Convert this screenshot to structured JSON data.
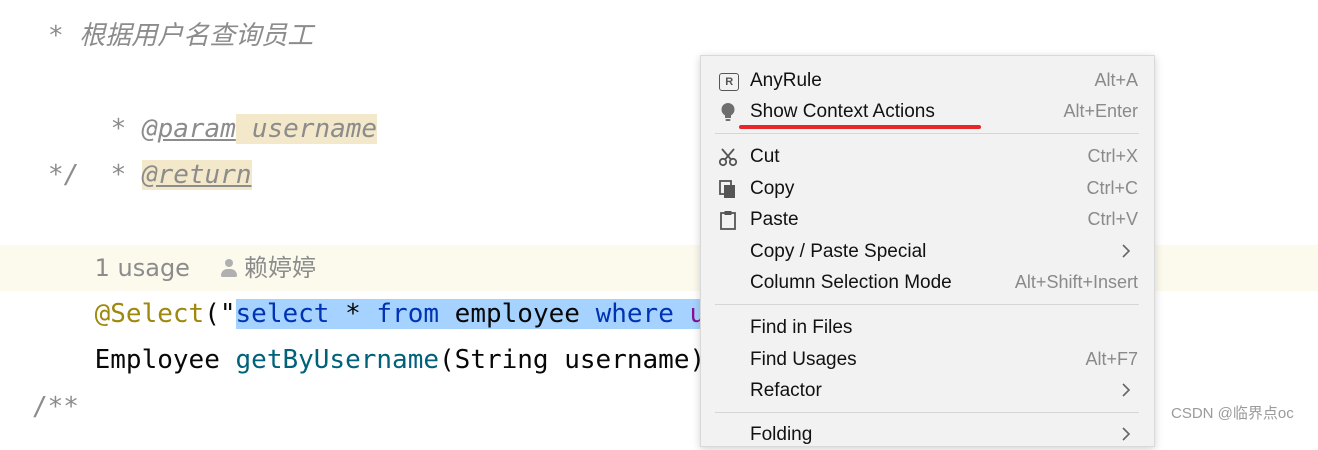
{
  "editor": {
    "comment_desc": "* 根据用户名查询员工",
    "param_star": "* ",
    "param_tag": "@param",
    "param_name": "username",
    "return_star": "* ",
    "return_tag": "@return",
    "comment_end": "*/",
    "usage_count": "1 usage",
    "author": "赖婷婷",
    "annotation": "@Select",
    "paren_quote": "(\"",
    "sel_select": "select",
    "sel_star": " * ",
    "sel_from": "from",
    "sel_table": " employee ",
    "sel_where": "where",
    "sel_user": " user",
    "method_return_type": "Employee ",
    "method_name": "getByUsername",
    "method_params": "(String username);",
    "next_comment": "/**"
  },
  "context_menu": {
    "items": [
      {
        "icon": "regex-icon",
        "glyph": "R",
        "label": "AnyRule",
        "shortcut": "Alt+A"
      },
      {
        "icon": "lightbulb-icon",
        "glyph": "💡",
        "label": "Show Context Actions",
        "shortcut": "Alt+Enter"
      },
      {
        "icon": "scissors-icon",
        "glyph": "✂",
        "label": "Cut",
        "shortcut": "Ctrl+X"
      },
      {
        "icon": "copy-icon",
        "glyph": "❐",
        "label": "Copy",
        "shortcut": "Ctrl+C"
      },
      {
        "icon": "clipboard-icon",
        "glyph": "📋",
        "label": "Paste",
        "shortcut": "Ctrl+V"
      },
      {
        "icon": "",
        "glyph": "",
        "label": "Copy / Paste Special",
        "shortcut": ""
      },
      {
        "icon": "",
        "glyph": "",
        "label": "Column Selection Mode",
        "shortcut": "Alt+Shift+Insert"
      },
      {
        "icon": "",
        "glyph": "",
        "label": "Find in Files",
        "shortcut": ""
      },
      {
        "icon": "",
        "glyph": "",
        "label": "Find Usages",
        "shortcut": "Alt+F7"
      },
      {
        "icon": "",
        "glyph": "",
        "label": "Refactor",
        "shortcut": ""
      },
      {
        "icon": "",
        "glyph": "",
        "label": "Folding",
        "shortcut": ""
      }
    ]
  },
  "colors": {
    "highlight_red": "#e8262a",
    "selection_blue": "#a6d2ff",
    "keyword_blue": "#0033b3"
  },
  "watermark": "CSDN @临界点oc"
}
